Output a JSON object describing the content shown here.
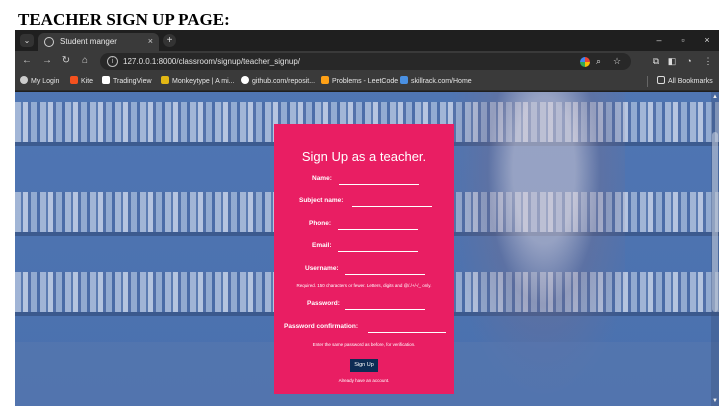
{
  "heading": "TEACHER SIGN UP PAGE:",
  "browser": {
    "tab_title": "Student manger",
    "tab_close": "×",
    "new_tab": "+",
    "url": "127.0.0.1:8000/classroom/signup/teacher_signup/",
    "window_controls": {
      "minimize": "–",
      "restore": "▫",
      "close": "×"
    }
  },
  "bookmarks": [
    {
      "label": "My Login",
      "color": "#cccccc"
    },
    {
      "label": "Kite",
      "color": "#f4511e"
    },
    {
      "label": "TradingView",
      "color": "#ffffff"
    },
    {
      "label": "Monkeytype | A mi...",
      "color": "#e2b714"
    },
    {
      "label": "github.com/reposit...",
      "color": "#ffffff"
    },
    {
      "label": "Problems - LeetCode",
      "color": "#ffa116"
    },
    {
      "label": "skillrack.com/Home",
      "color": "#4a90e2"
    }
  ],
  "all_bookmarks": "All Bookmarks",
  "form": {
    "title": "Sign Up as a teacher.",
    "fields": {
      "name": "Name:",
      "subject": "Subject name:",
      "phone": "Phone:",
      "email": "Email:",
      "username": "Username:",
      "password": "Password:",
      "password_confirmation": "Password confirmation:"
    },
    "username_help": "Required. 150 characters or fewer. Letters, digits and @/./+/-/_ only.",
    "password_help": "Enter the same password as before, for verification.",
    "submit": "Sign Up",
    "login_link": "Already have an account."
  },
  "colors": {
    "card": "#e91e63",
    "button": "#0d2c54"
  }
}
